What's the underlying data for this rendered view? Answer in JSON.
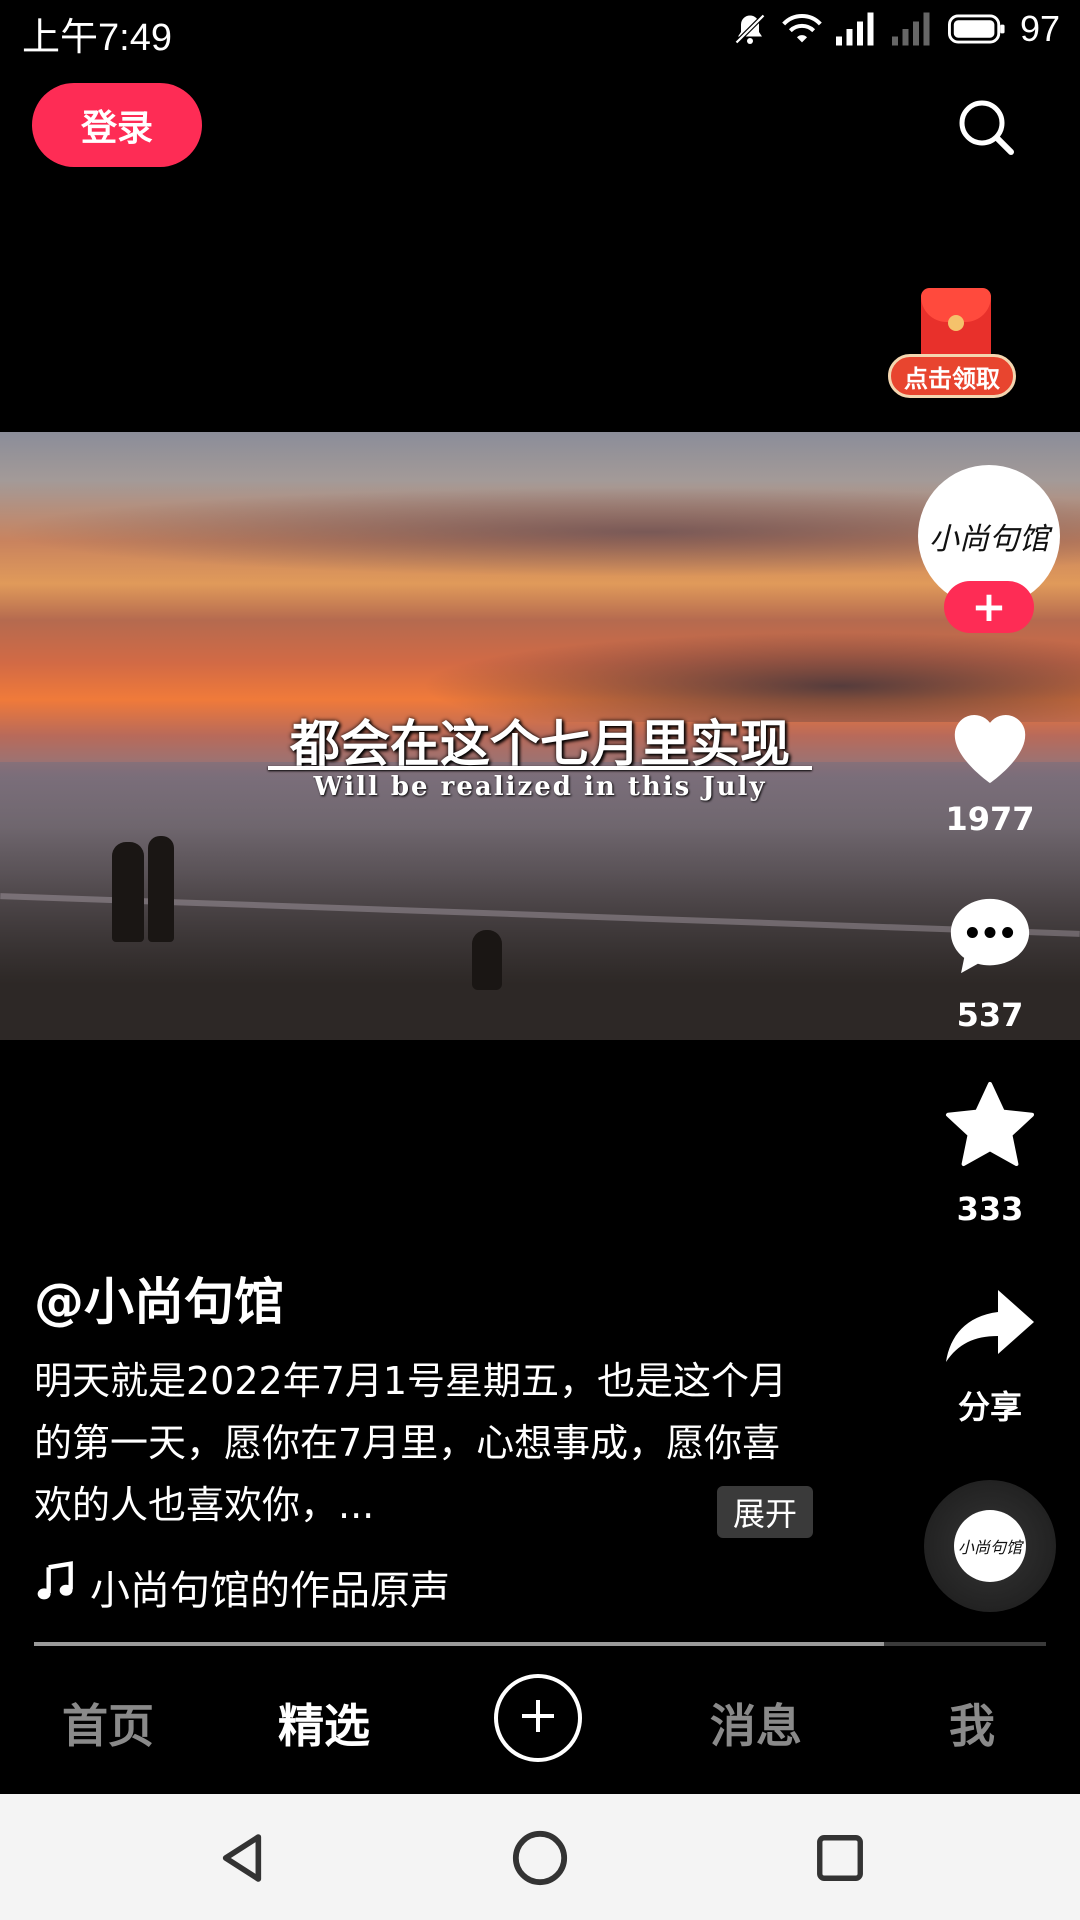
{
  "status_bar": {
    "time": "上午7:49",
    "battery": "97",
    "icons": [
      "mute-bell-icon",
      "wifi-icon",
      "signal-icon",
      "signal-empty-icon",
      "battery-icon"
    ]
  },
  "header": {
    "login_label": "登录",
    "search_icon": "search-icon"
  },
  "red_packet": {
    "label": "点击领取"
  },
  "video": {
    "caption_cn": "都会在这个七月里实现",
    "caption_en": "Will be realized in this July"
  },
  "author_avatar": {
    "text": "小尚句馆"
  },
  "right_rail": {
    "follow_symbol": "+",
    "likes": "1977",
    "comments": "537",
    "favorites": "333",
    "share_label": "分享"
  },
  "post": {
    "author": "@小尚句馆",
    "description": "明天就是2022年7月1号星期五，也是这个月的第一天，愿你在7月里，心想事成，愿你喜欢的人也喜欢你，...",
    "expand_label": "展开",
    "music": "小尚句馆的作品原声"
  },
  "progress": {
    "fraction": 0.84
  },
  "tabs": [
    {
      "label": "首页"
    },
    {
      "label": "精选"
    },
    {
      "label": "消息"
    },
    {
      "label": "我"
    }
  ],
  "colors": {
    "accent": "#fe2c55",
    "background": "#000000"
  }
}
